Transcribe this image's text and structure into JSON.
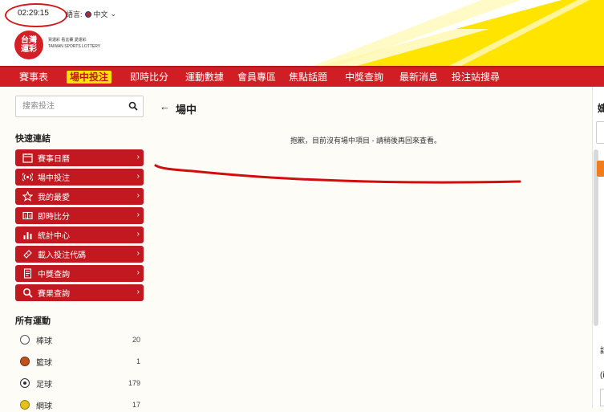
{
  "header": {
    "clock": "02:29:15",
    "language_label": "語言:",
    "language_value": "中文",
    "logo_line1": "台灣",
    "logo_line2": "運彩",
    "logo_tagline1": "買運彩 看比賽 愛運彩",
    "logo_tagline2": "TAIWAN SPORTS LOTTERY",
    "colors": {
      "red": "#d01e24",
      "yellow": "#ffe400"
    }
  },
  "nav": {
    "items": [
      "賽事表",
      "場中投注",
      "即時比分",
      "運動數據",
      "會員專區",
      "焦點話題",
      "中獎查詢",
      "最新消息",
      "投注站搜尋"
    ],
    "active": "場中投注"
  },
  "sidebar": {
    "search_placeholder": "搜索投注",
    "quick_links_title": "快速連結",
    "quick_links": [
      {
        "label": "賽事日曆",
        "icon": "calendar-icon"
      },
      {
        "label": "場中投注",
        "icon": "live-broadcast-icon"
      },
      {
        "label": "我的最愛",
        "icon": "star-icon"
      },
      {
        "label": "即時比分",
        "icon": "scoreboard-icon"
      },
      {
        "label": "統計中心",
        "icon": "bar-chart-icon"
      },
      {
        "label": "載入投注代碼",
        "icon": "ticket-icon"
      },
      {
        "label": "中獎查詢",
        "icon": "receipt-icon"
      },
      {
        "label": "賽果查詢",
        "icon": "search-icon"
      }
    ],
    "sports_title": "所有運動",
    "sports": [
      {
        "name": "棒球",
        "count": "20",
        "icon": "baseball-icon"
      },
      {
        "name": "籃球",
        "count": "1",
        "icon": "basketball-icon"
      },
      {
        "name": "足球",
        "count": "179",
        "icon": "soccer-ball-icon"
      },
      {
        "name": "網球",
        "count": "17",
        "icon": "tennis-ball-icon"
      }
    ]
  },
  "main": {
    "back_arrow": "←",
    "title": "場中",
    "empty_message": "抱歉，目前沒有場中項目 - 請稍後再回來查看。"
  },
  "right_panel": {
    "title_fragment": "婕",
    "text1": "話",
    "text2": "(i"
  }
}
